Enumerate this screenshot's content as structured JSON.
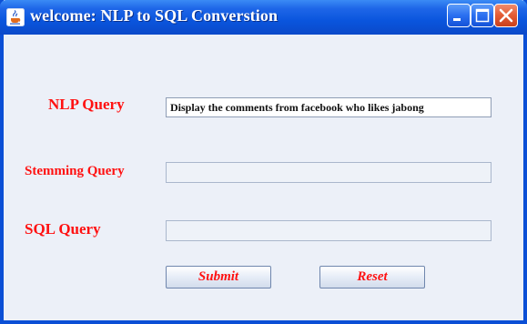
{
  "window": {
    "title": "welcome: NLP to SQL Converstion",
    "icon": "java-cup-icon",
    "controls": [
      "minimize-icon",
      "maximize-icon",
      "close-icon"
    ]
  },
  "form": {
    "nlp_label": "NLP Query",
    "nlp_value": "Display the comments from facebook who likes jabong",
    "stemming_label": "Stemming Query",
    "stemming_value": "",
    "sql_label": "SQL Query",
    "sql_value": ""
  },
  "buttons": {
    "submit": "Submit",
    "reset": "Reset"
  },
  "colors": {
    "label": "#ff1111",
    "titlebar": "#0a55dd",
    "background": "#ecf0f8"
  }
}
